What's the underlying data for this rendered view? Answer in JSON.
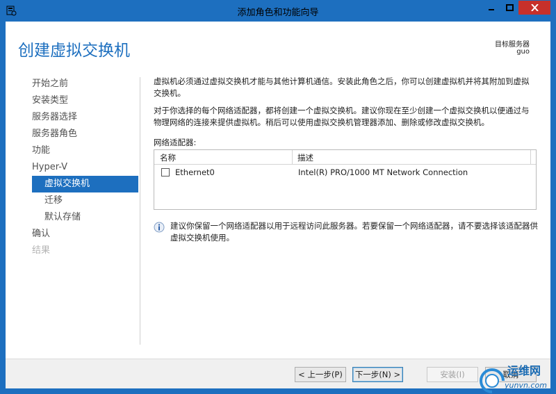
{
  "window": {
    "title": "添加角色和功能向导",
    "accent": "#1d6fbf",
    "close_color": "#c7302a"
  },
  "header": {
    "page_title": "创建虚拟交换机",
    "target_server_label": "目标服务器",
    "target_server_name": "guo"
  },
  "nav": {
    "items": [
      {
        "label": "开始之前",
        "state": "normal"
      },
      {
        "label": "安装类型",
        "state": "normal"
      },
      {
        "label": "服务器选择",
        "state": "normal"
      },
      {
        "label": "服务器角色",
        "state": "normal"
      },
      {
        "label": "功能",
        "state": "normal"
      },
      {
        "label": "Hyper-V",
        "state": "normal"
      },
      {
        "label": "虚拟交换机",
        "state": "active"
      },
      {
        "label": "迁移",
        "state": "sub"
      },
      {
        "label": "默认存储",
        "state": "sub"
      },
      {
        "label": "确认",
        "state": "normal"
      },
      {
        "label": "结果",
        "state": "disabled"
      }
    ]
  },
  "content": {
    "para1": "虚拟机必须通过虚拟交换机才能与其他计算机通信。安装此角色之后，你可以创建虚拟机并将其附加到虚拟交换机。",
    "para2": "对于你选择的每个网络适配器，都将创建一个虚拟交换机。建议你现在至少创建一个虚拟交换机以便通过与物理网络的连接来提供虚拟机。稍后可以使用虚拟交换机管理器添加、删除或修改虚拟交换机。",
    "adapters_label": "网络适配器:",
    "grid": {
      "columns": [
        "名称",
        "描述"
      ],
      "rows": [
        {
          "checked": false,
          "name": "Ethernet0",
          "description": "Intel(R) PRO/1000 MT Network Connection"
        }
      ]
    },
    "info_text": "建议你保留一个网络适配器以用于远程访问此服务器。若要保留一个网络适配器，请不要选择该适配器供虚拟交换机使用。"
  },
  "footer": {
    "prev_label": "< 上一步(P)",
    "next_label": "下一步(N) >",
    "install_label": "安装(I)",
    "cancel_label": "取消"
  },
  "watermark": {
    "site_cn": "运维网",
    "site_url": "yunvn.com"
  }
}
